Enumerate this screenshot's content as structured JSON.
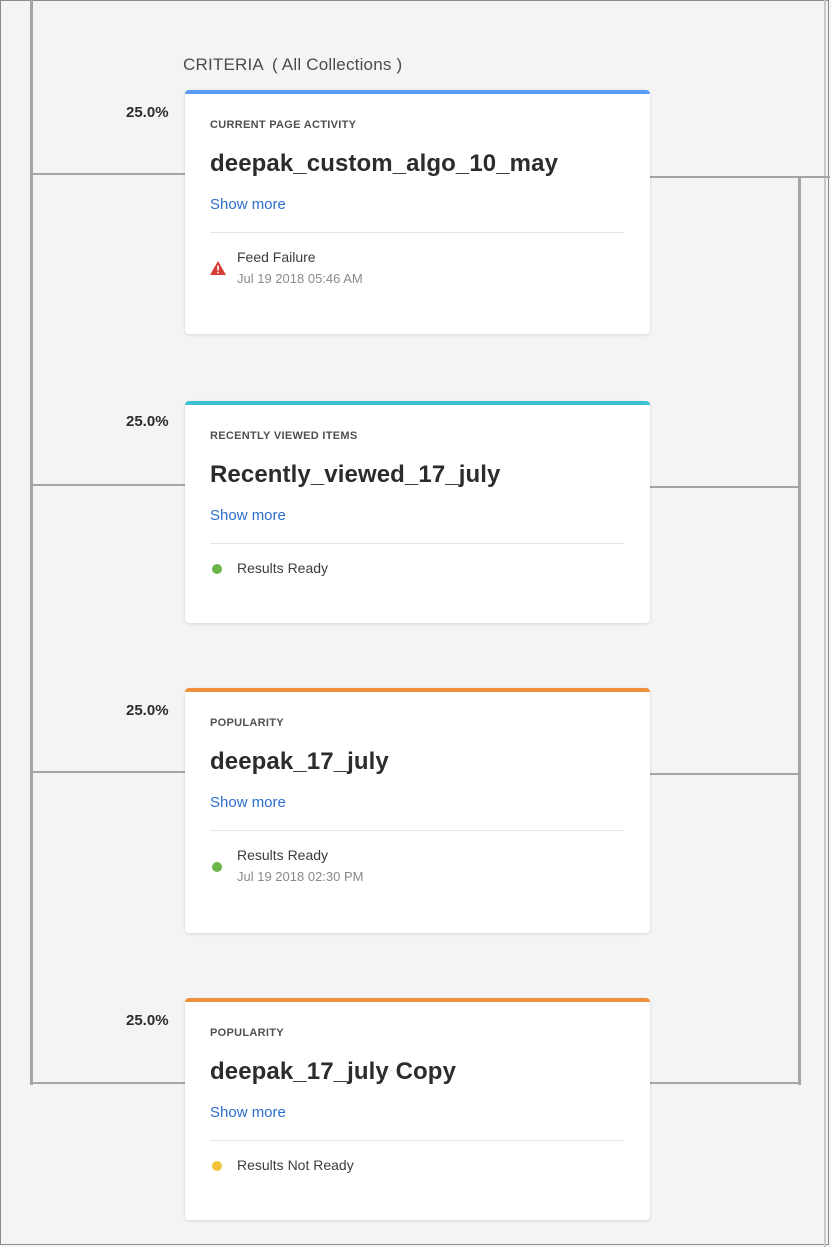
{
  "header": {
    "criteria": "CRITERIA",
    "collections": "( All Collections )"
  },
  "colors": {
    "blue": "#5b9cf0",
    "teal": "#3fc1d3",
    "orange": "#f08f3c",
    "green": "#6ab64a",
    "yellow": "#f2c43b",
    "red": "#d63c36",
    "link": "#2d6ecc"
  },
  "cards": [
    {
      "weight": "25.0%",
      "type": "CURRENT PAGE ACTIVITY",
      "name": "deepak_custom_algo_10_may",
      "show_more": "Show more",
      "status": "Feed Failure",
      "status_icon": "warning-icon",
      "time": "Jul 19 2018 05:46 AM"
    },
    {
      "weight": "25.0%",
      "type": "RECENTLY VIEWED ITEMS",
      "name": "Recently_viewed_17_july",
      "show_more": "Show more",
      "status": "Results Ready",
      "status_icon": "green-dot-icon"
    },
    {
      "weight": "25.0%",
      "type": "POPULARITY",
      "name": "deepak_17_july",
      "show_more": "Show more",
      "status": "Results Ready",
      "status_icon": "green-dot-icon",
      "time": "Jul 19 2018 02:30 PM"
    },
    {
      "weight": "25.0%",
      "type": "POPULARITY",
      "name": "deepak_17_july Copy",
      "show_more": "Show more",
      "status": "Results Not Ready",
      "status_icon": "yellow-dot-icon"
    }
  ]
}
